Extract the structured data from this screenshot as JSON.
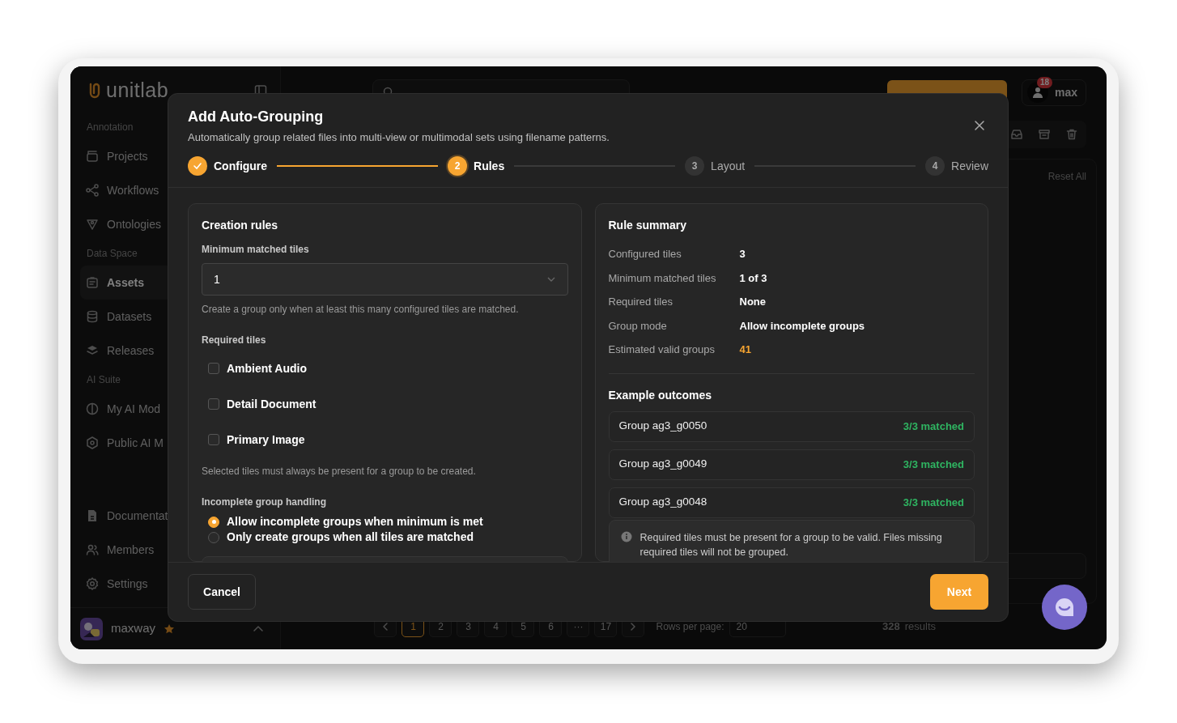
{
  "sidebar": {
    "logo": "unitlab",
    "sections": [
      {
        "heading": "Annotation",
        "items": [
          {
            "label": "Projects",
            "selected": false
          },
          {
            "label": "Workflows",
            "selected": false
          },
          {
            "label": "Ontologies",
            "selected": false
          }
        ]
      },
      {
        "heading": "Data Space",
        "items": [
          {
            "label": "Assets",
            "selected": true
          },
          {
            "label": "Datasets",
            "selected": false
          },
          {
            "label": "Releases",
            "selected": false
          }
        ]
      },
      {
        "heading": "AI Suite",
        "items": [
          {
            "label": "My AI Mod",
            "selected": false
          },
          {
            "label": "Public AI M",
            "selected": false
          }
        ]
      }
    ],
    "bottom_items": [
      {
        "label": "Documentat",
        "selected": false
      },
      {
        "label": "Members",
        "selected": false
      },
      {
        "label": "Settings",
        "selected": false
      }
    ],
    "user": {
      "name": "maxway"
    }
  },
  "topbar": {
    "user": {
      "name": "max",
      "notifications": "18"
    }
  },
  "filters": {
    "reset": "Reset All"
  },
  "pagination": {
    "pages": [
      {
        "label": "1",
        "selected": true
      },
      {
        "label": "2",
        "selected": false
      },
      {
        "label": "3",
        "selected": false
      },
      {
        "label": "4",
        "selected": false
      },
      {
        "label": "5",
        "selected": false
      },
      {
        "label": "6",
        "selected": false
      },
      {
        "label": "···",
        "selected": false
      },
      {
        "label": "17",
        "selected": false
      }
    ],
    "rows_label": "Rows per page:",
    "rows_value": "20",
    "results_count": "328",
    "results_label": "results"
  },
  "modal": {
    "title": "Add Auto-Grouping",
    "subtitle": "Automatically group related files into multi-view or multimodal sets using filename patterns.",
    "steps": [
      {
        "label": "Configure",
        "completed": true,
        "selected": false
      },
      {
        "number": "2",
        "label": "Rules",
        "completed": false,
        "selected": true
      },
      {
        "number": "3",
        "label": "Layout",
        "completed": false,
        "selected": false
      },
      {
        "number": "4",
        "label": "Review",
        "completed": false,
        "selected": false
      }
    ],
    "creation_rules": {
      "title": "Creation rules",
      "min_label": "Minimum matched tiles",
      "min_value": "1",
      "min_help": "Create a group only when at least this many configured tiles are matched.",
      "required_label": "Required tiles",
      "tiles": [
        {
          "label": "Ambient Audio",
          "checked": false
        },
        {
          "label": "Detail Document",
          "checked": false
        },
        {
          "label": "Primary Image",
          "checked": false
        }
      ],
      "required_help": "Selected tiles must always be present for a group to be created.",
      "handling_label": "Incomplete group handling",
      "handling_options": [
        {
          "label": "Allow incomplete groups when minimum is met",
          "selected": true
        },
        {
          "label": "Only create groups when all tiles are matched",
          "selected": false
        }
      ]
    },
    "summary": {
      "title": "Rule summary",
      "rows": [
        {
          "label": "Configured tiles",
          "value": "3",
          "highlight": false
        },
        {
          "label": "Minimum matched tiles",
          "value": "1 of 3",
          "highlight": false
        },
        {
          "label": "Required tiles",
          "value": "None",
          "highlight": false
        },
        {
          "label": "Group mode",
          "value": "Allow incomplete groups",
          "highlight": false
        },
        {
          "label": "Estimated valid groups",
          "value": "41",
          "highlight": true
        }
      ],
      "examples_title": "Example outcomes",
      "examples": [
        {
          "name": "Group ag3_g0050",
          "status": "3/3 matched"
        },
        {
          "name": "Group ag3_g0049",
          "status": "3/3 matched"
        },
        {
          "name": "Group ag3_g0048",
          "status": "3/3 matched"
        }
      ],
      "note": "Required tiles must be present for a group to be valid. Files missing required tiles will not be grouped."
    },
    "buttons": {
      "cancel": "Cancel",
      "next": "Next"
    }
  }
}
